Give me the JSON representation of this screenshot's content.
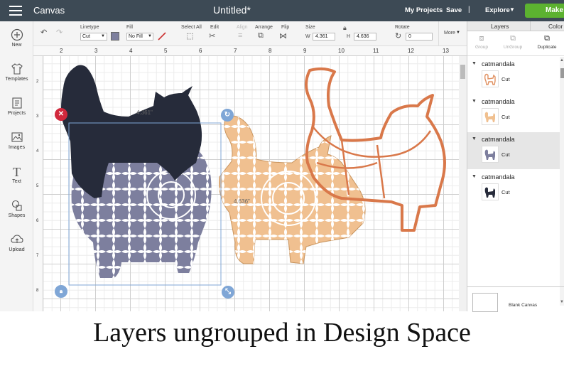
{
  "topbar": {
    "canvas_label": "Canvas",
    "title": "Untitled*",
    "my_projects": "My Projects",
    "save": "Save",
    "separator": "|",
    "explore": "Explore",
    "make": "Make"
  },
  "toolbar": {
    "linetype_label": "Linetype",
    "linetype_value": "Cut",
    "fill_label": "Fill",
    "fill_value": "No Fill",
    "select_all_label": "Select All",
    "edit_label": "Edit",
    "align_label": "Align",
    "arrange_label": "Arrange",
    "flip_label": "Flip",
    "size_label": "Size",
    "w_label": "W",
    "w_value": "4.361",
    "h_label": "H",
    "h_value": "4.636",
    "rotate_label": "Rotate",
    "rotate_value": "0",
    "more_label": "More",
    "linetype_color": "#7d7f9e"
  },
  "leftbar": {
    "items": [
      {
        "label": "New",
        "icon": "plus-circle-icon"
      },
      {
        "label": "Templates",
        "icon": "shirt-icon"
      },
      {
        "label": "Projects",
        "icon": "projects-icon"
      },
      {
        "label": "Images",
        "icon": "image-icon"
      },
      {
        "label": "Text",
        "icon": "text-icon"
      },
      {
        "label": "Shapes",
        "icon": "shapes-icon"
      },
      {
        "label": "Upload",
        "icon": "upload-icon"
      }
    ]
  },
  "ruler": {
    "top": [
      "2",
      "3",
      "4",
      "5",
      "6",
      "7",
      "8",
      "9",
      "10",
      "11",
      "12",
      "13"
    ],
    "left": [
      "2",
      "3",
      "4",
      "5",
      "6",
      "7",
      "8"
    ]
  },
  "canvas": {
    "width_dim": "4.361\"",
    "height_dim": "4.636\""
  },
  "panel": {
    "tab_layers": "Layers",
    "tab_color": "Color",
    "group": "Group",
    "ungroup": "UnGroup",
    "duplicate": "Duplicate",
    "layers": [
      {
        "name": "catmandala",
        "op": "Cut",
        "color": "#e09060"
      },
      {
        "name": "catmandala",
        "op": "Cut",
        "color": "#f0c090"
      },
      {
        "name": "catmandala",
        "op": "Cut",
        "color": "#7d7f9e"
      },
      {
        "name": "catmandala",
        "op": "Cut",
        "color": "#262b3a"
      }
    ],
    "blank_canvas": "Blank Canvas"
  },
  "caption": "Layers ungrouped in Design Space",
  "colors": {
    "topbar": "#3d4a55",
    "make_button": "#5cb230",
    "cat_dark": "#262b3a",
    "cat_purple": "#7d7f9e",
    "cat_peach": "#f0c090",
    "cat_orange": "#d9784a",
    "selection": "#7fa6d6"
  }
}
